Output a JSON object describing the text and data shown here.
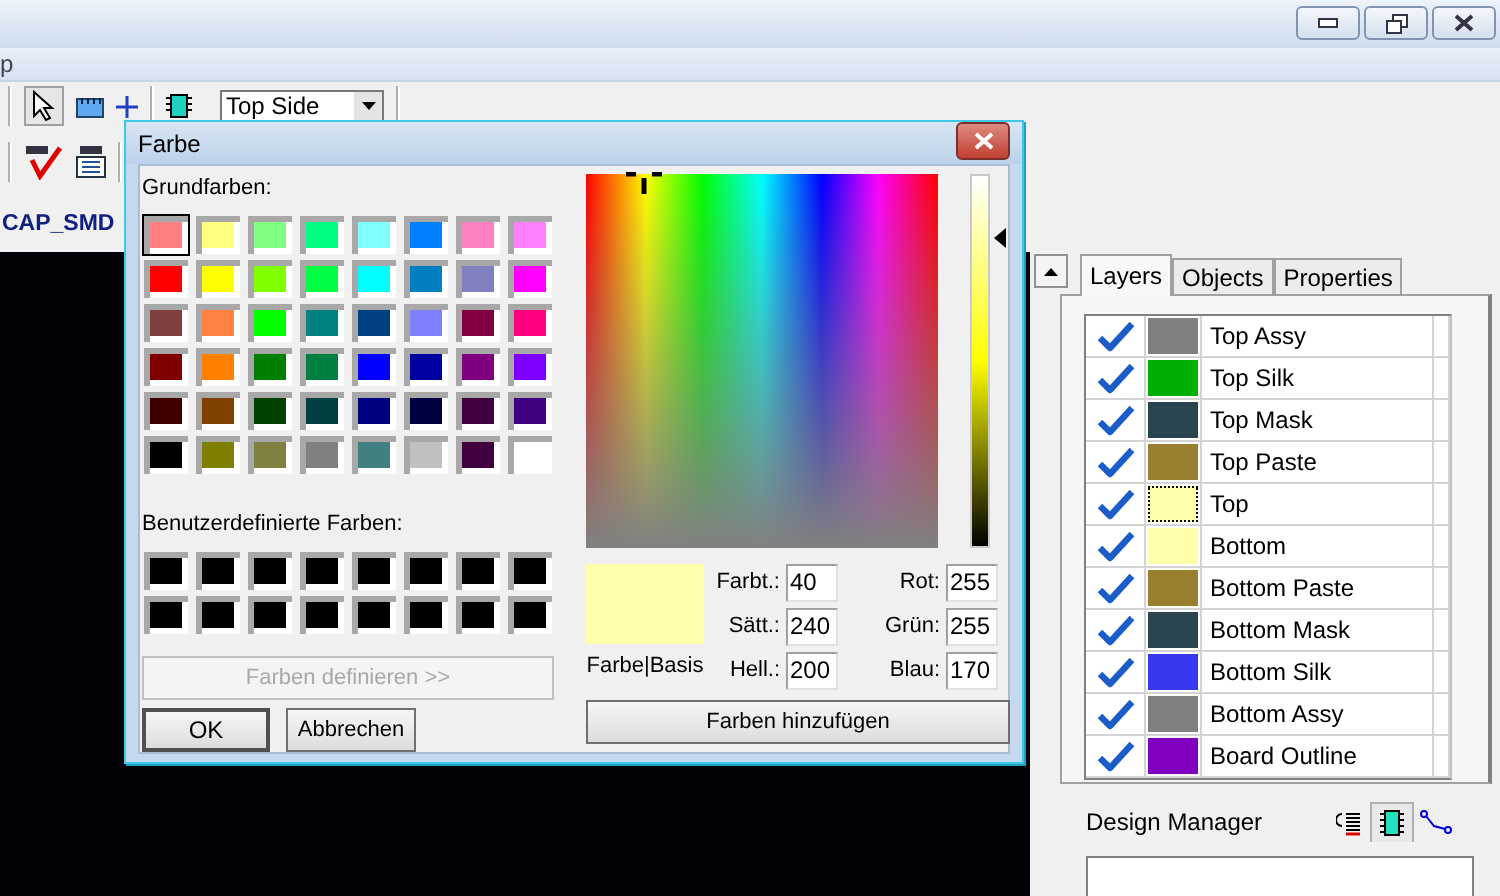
{
  "app": {
    "menu_fragment": "p",
    "layer_select": "Top Side",
    "part_name": "CAP_SMD"
  },
  "panel": {
    "tabs": [
      {
        "label": "Layers",
        "selected": true
      },
      {
        "label": "Objects",
        "selected": false
      },
      {
        "label": "Properties",
        "selected": false
      }
    ],
    "layers": [
      {
        "name": "Top Assy",
        "visible": true,
        "color": "#808080",
        "focused": false
      },
      {
        "name": "Top Silk",
        "visible": true,
        "color": "#00b000",
        "focused": false
      },
      {
        "name": "Top Mask",
        "visible": true,
        "color": "#2a4450",
        "focused": false
      },
      {
        "name": "Top Paste",
        "visible": true,
        "color": "#988030",
        "focused": false
      },
      {
        "name": "Top",
        "visible": true,
        "color": "#ffffaa",
        "focused": true
      },
      {
        "name": "Bottom",
        "visible": true,
        "color": "#ffffaa",
        "focused": false
      },
      {
        "name": "Bottom Paste",
        "visible": true,
        "color": "#988030",
        "focused": false
      },
      {
        "name": "Bottom Mask",
        "visible": true,
        "color": "#2a4450",
        "focused": false
      },
      {
        "name": "Bottom Silk",
        "visible": true,
        "color": "#3838f0",
        "focused": false
      },
      {
        "name": "Bottom Assy",
        "visible": true,
        "color": "#808080",
        "focused": false
      },
      {
        "name": "Board Outline",
        "visible": true,
        "color": "#8000c0",
        "focused": false
      }
    ],
    "design_manager": {
      "title": "Design Manager"
    }
  },
  "dialog": {
    "title": "Farbe",
    "basic_colors_label": "Grundfarben:",
    "basic_colors": [
      {
        "color": "#ff8080",
        "selected": true
      },
      {
        "color": "#ffff80",
        "selected": false
      },
      {
        "color": "#80ff80",
        "selected": false
      },
      {
        "color": "#00ff80",
        "selected": false
      },
      {
        "color": "#80ffff",
        "selected": false
      },
      {
        "color": "#0080ff",
        "selected": false
      },
      {
        "color": "#ff80c0",
        "selected": false
      },
      {
        "color": "#ff80ff",
        "selected": false
      },
      {
        "color": "#ff0000",
        "selected": false
      },
      {
        "color": "#ffff00",
        "selected": false
      },
      {
        "color": "#80ff00",
        "selected": false
      },
      {
        "color": "#00ff40",
        "selected": false
      },
      {
        "color": "#00ffff",
        "selected": false
      },
      {
        "color": "#0080c0",
        "selected": false
      },
      {
        "color": "#8080c0",
        "selected": false
      },
      {
        "color": "#ff00ff",
        "selected": false
      },
      {
        "color": "#804040",
        "selected": false
      },
      {
        "color": "#ff8040",
        "selected": false
      },
      {
        "color": "#00ff00",
        "selected": false
      },
      {
        "color": "#008080",
        "selected": false
      },
      {
        "color": "#004080",
        "selected": false
      },
      {
        "color": "#8080ff",
        "selected": false
      },
      {
        "color": "#800040",
        "selected": false
      },
      {
        "color": "#ff0080",
        "selected": false
      },
      {
        "color": "#800000",
        "selected": false
      },
      {
        "color": "#ff8000",
        "selected": false
      },
      {
        "color": "#008000",
        "selected": false
      },
      {
        "color": "#008040",
        "selected": false
      },
      {
        "color": "#0000ff",
        "selected": false
      },
      {
        "color": "#0000a0",
        "selected": false
      },
      {
        "color": "#800080",
        "selected": false
      },
      {
        "color": "#8000ff",
        "selected": false
      },
      {
        "color": "#400000",
        "selected": false
      },
      {
        "color": "#804000",
        "selected": false
      },
      {
        "color": "#004000",
        "selected": false
      },
      {
        "color": "#004040",
        "selected": false
      },
      {
        "color": "#000080",
        "selected": false
      },
      {
        "color": "#000040",
        "selected": false
      },
      {
        "color": "#400040",
        "selected": false
      },
      {
        "color": "#400080",
        "selected": false
      },
      {
        "color": "#000000",
        "selected": false
      },
      {
        "color": "#808000",
        "selected": false
      },
      {
        "color": "#808040",
        "selected": false
      },
      {
        "color": "#808080",
        "selected": false
      },
      {
        "color": "#408080",
        "selected": false
      },
      {
        "color": "#c0c0c0",
        "selected": false
      },
      {
        "color": "#400040",
        "selected": false
      },
      {
        "color": "#ffffff",
        "selected": false
      }
    ],
    "custom_colors_label": "Benutzerdefinierte Farben:",
    "custom_colors": [
      {
        "color": "#000000"
      },
      {
        "color": "#000000"
      },
      {
        "color": "#000000"
      },
      {
        "color": "#000000"
      },
      {
        "color": "#000000"
      },
      {
        "color": "#000000"
      },
      {
        "color": "#000000"
      },
      {
        "color": "#000000"
      },
      {
        "color": "#000000"
      },
      {
        "color": "#000000"
      },
      {
        "color": "#000000"
      },
      {
        "color": "#000000"
      },
      {
        "color": "#000000"
      },
      {
        "color": "#000000"
      },
      {
        "color": "#000000"
      },
      {
        "color": "#000000"
      }
    ],
    "define_button": {
      "label": "Farben definieren >>",
      "disabled": true
    },
    "ok_button": "OK",
    "cancel_button": "Abbrechen",
    "luminance": {
      "level": 0.83
    },
    "preview": {
      "color": "#ffffaa",
      "label": "Farbe|Basis"
    },
    "hsl_fields": [
      {
        "label": "Farbt.:",
        "value": "40"
      },
      {
        "label": "Sätt.:",
        "value": "240"
      },
      {
        "label": "Hell.:",
        "value": "200"
      }
    ],
    "rgb_fields": [
      {
        "label": "Rot:",
        "value": "255"
      },
      {
        "label": "Grün:",
        "value": "255"
      },
      {
        "label": "Blau:",
        "value": "170"
      }
    ],
    "add_button": "Farben hinzufügen"
  }
}
